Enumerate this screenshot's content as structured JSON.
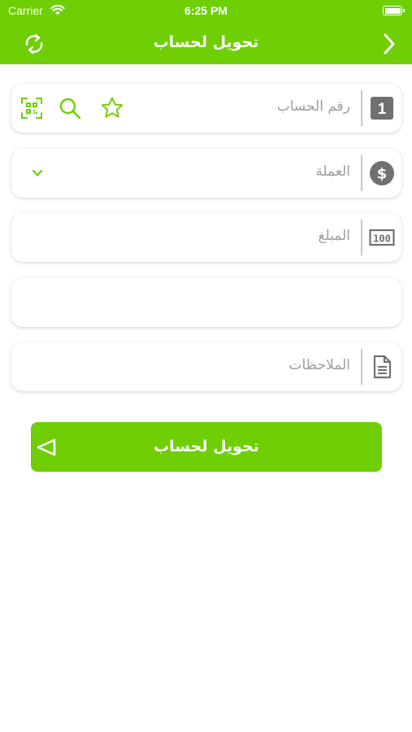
{
  "status_bar": {
    "carrier": "Carrier",
    "time": "6:25 PM"
  },
  "header": {
    "title": "تحويل لحساب"
  },
  "form": {
    "account_number": {
      "placeholder": "رقم الحساب",
      "badge": "1"
    },
    "currency": {
      "placeholder": "العملة",
      "icon_symbol": "$"
    },
    "amount": {
      "placeholder": "المبلغ",
      "icon_text": "100"
    },
    "blank_field": {
      "value": ""
    },
    "notes": {
      "placeholder": "الملاحظات"
    }
  },
  "submit": {
    "label": "تحويل لحساب"
  },
  "colors": {
    "accent": "#6fcf04",
    "placeholder": "#9e9e9e",
    "icon_gray": "#707070"
  }
}
